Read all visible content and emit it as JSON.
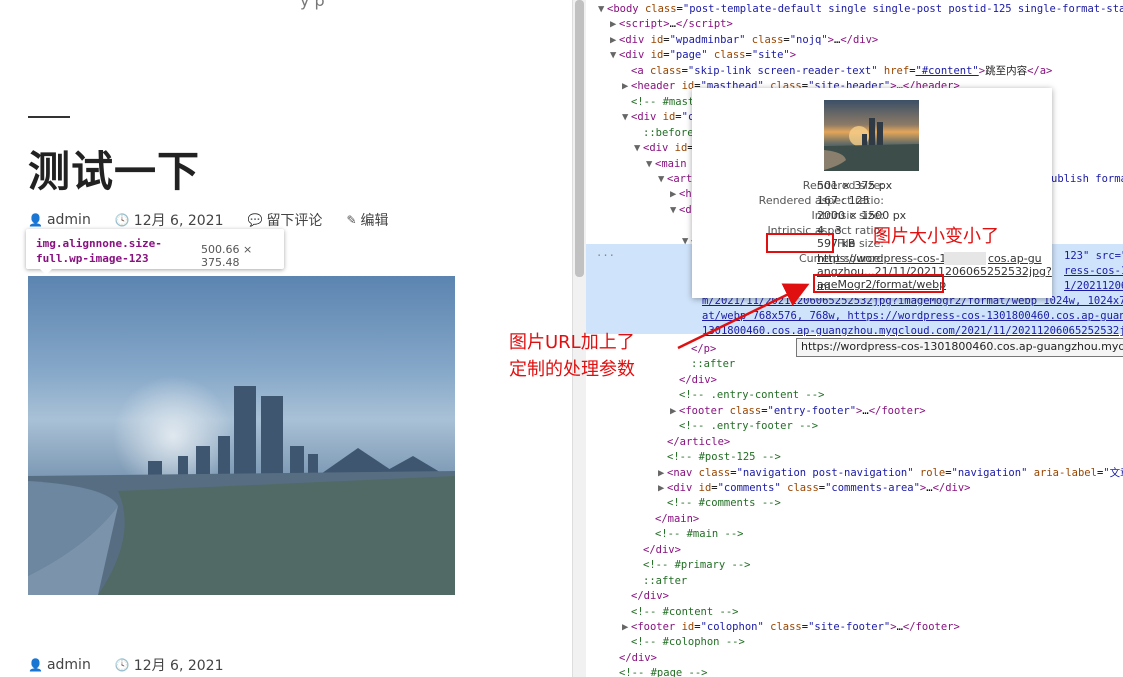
{
  "blog": {
    "top_cut_text": "y  p",
    "post_title": "测试一下",
    "meta1": {
      "author": "admin",
      "date": "12月 6, 2021",
      "comment": "留下评论",
      "edit": "编辑"
    },
    "meta2": {
      "author": "admin",
      "date": "12月 6, 2021"
    },
    "tooltip": {
      "selector": "img.alignnone.size-full.wp-image-123",
      "dimensions": "500.66 × 375.48"
    }
  },
  "devtools": {
    "lines": [
      {
        "t": "▼",
        "h": "<span class='tg'>&lt;body</span> <span class='at'>class</span>=<span class='av'>\"post-template-default single single-post postid-125 single-format-stan</span>"
      },
      {
        "t": "▶",
        "h": "<span class='tg'>&lt;script&gt;</span>…<span class='tg'>&lt;/script&gt;</span>"
      },
      {
        "t": "▶",
        "h": "<span class='tg'>&lt;div</span> <span class='at'>id</span>=<span class='av'>\"wpadminbar\"</span> <span class='at'>class</span>=<span class='av'>\"nojq\"</span><span class='tg'>&gt;</span>…<span class='tg'>&lt;/div&gt;</span>"
      },
      {
        "t": "▼",
        "h": "<span class='tg'>&lt;div</span> <span class='at'>id</span>=<span class='av'>\"page\"</span> <span class='at'>class</span>=<span class='av'>\"site\"</span><span class='tg'>&gt;</span>"
      },
      {
        "t": "",
        "h": "<span class='tg'>&lt;a</span> <span class='at'>class</span>=<span class='av'>\"skip-link screen-reader-text\"</span> <span class='at'>href</span>=<span class='lk'>\"#content\"</span><span class='tg'>&gt;</span><span class='tx'>跳至内容</span><span class='tg'>&lt;/a&gt;</span>"
      },
      {
        "t": "▶",
        "h": "<span class='tg'>&lt;header</span> <span class='at'>id</span>=<span class='av'>\"masthead\"</span> <span class='at'>class</span>=<span class='av'>\"site-header\"</span><span class='tg'>&gt;</span>…<span class='tg'>&lt;/header&gt;</span>"
      },
      {
        "t": "",
        "h": "<span class='cm'>&lt;!-- #mast</span>"
      },
      {
        "t": "▼",
        "h": "<span class='tg'>&lt;div</span> <span class='at'>id</span>=<span class='av'>\"c</span>"
      },
      {
        "t": "",
        "h": "<span class='cm'>::before</span>"
      },
      {
        "t": "▼",
        "h": "<span class='tg'>&lt;div</span> <span class='at'>id</span>="
      },
      {
        "t": "▼",
        "h": "<span class='tg'>&lt;main</span>"
      },
      {
        "t": "▼",
        "h": "<span class='tg'>&lt;art</span>"
      },
      {
        "t": "▶",
        "h": "<span class='tg'>&lt;h</span>"
      },
      {
        "t": "▼",
        "h": "<span class='tg'>&lt;di</span>"
      },
      {
        "t": "",
        "h": ""
      },
      {
        "t": "▼",
        "h": "<span class='tg'>&lt;</span>"
      },
      {
        "t": "",
        "h": ""
      },
      {
        "t": "",
        "h": ""
      },
      {
        "t": "",
        "h": ""
      },
      {
        "t": "",
        "h": ""
      },
      {
        "t": "",
        "h": ""
      },
      {
        "t": "",
        "h": ""
      },
      {
        "t": "",
        "h": "<span class='tg'>&lt;/p&gt;</span>"
      },
      {
        "t": "",
        "h": "<span class='cm'>::after</span>"
      },
      {
        "t": "",
        "h": "<span class='tg'>&lt;/div&gt;</span>"
      },
      {
        "t": "",
        "h": "<span class='cm'>&lt;!-- .entry-content --&gt;</span>"
      },
      {
        "t": "▶",
        "h": "<span class='tg'>&lt;footer</span> <span class='at'>class</span>=<span class='av'>\"entry-footer\"</span><span class='tg'>&gt;</span>…<span class='tg'>&lt;/footer&gt;</span>"
      },
      {
        "t": "",
        "h": "<span class='cm'>&lt;!-- .entry-footer --&gt;</span>"
      },
      {
        "t": "",
        "h": "<span class='tg'>&lt;/article&gt;</span>"
      },
      {
        "t": "",
        "h": "<span class='cm'>&lt;!-- #post-125 --&gt;</span>"
      },
      {
        "t": "▶",
        "h": "<span class='tg'>&lt;nav</span> <span class='at'>class</span>=<span class='av'>\"navigation post-navigation\"</span> <span class='at'>role</span>=<span class='av'>\"navigation\"</span> <span class='at'>aria-label</span>=<span class='av'>\"文章</span>"
      },
      {
        "t": "▶",
        "h": "<span class='tg'>&lt;div</span> <span class='at'>id</span>=<span class='av'>\"comments\"</span> <span class='at'>class</span>=<span class='av'>\"comments-area\"</span><span class='tg'>&gt;</span>…<span class='tg'>&lt;/div&gt;</span>"
      },
      {
        "t": "",
        "h": "<span class='cm'>&lt;!-- #comments --&gt;</span>"
      },
      {
        "t": "",
        "h": "<span class='tg'>&lt;/main&gt;</span>"
      },
      {
        "t": "",
        "h": "<span class='cm'>&lt;!-- #main --&gt;</span>"
      },
      {
        "t": "",
        "h": "<span class='tg'>&lt;/div&gt;</span>"
      },
      {
        "t": "",
        "h": "<span class='cm'>&lt;!-- #primary --&gt;</span>"
      },
      {
        "t": "",
        "h": "<span class='cm'>::after</span>"
      },
      {
        "t": "",
        "h": "<span class='tg'>&lt;/div&gt;</span>"
      },
      {
        "t": "",
        "h": "<span class='cm'>&lt;!-- #content --&gt;</span>"
      },
      {
        "t": "▶",
        "h": "<span class='tg'>&lt;footer</span> <span class='at'>id</span>=<span class='av'>\"colophon\"</span> <span class='at'>class</span>=<span class='av'>\"site-footer\"</span><span class='tg'>&gt;</span>…<span class='tg'>&lt;/footer&gt;</span>"
      },
      {
        "t": "",
        "h": "<span class='cm'>&lt;!-- #colophon --&gt;</span>"
      },
      {
        "t": "",
        "h": "<span class='tg'>&lt;/div&gt;</span>"
      },
      {
        "t": "",
        "h": "<span class='cm'>&lt;!-- #page --&gt;</span>"
      }
    ],
    "line_indents": [
      2,
      3,
      3,
      3,
      4,
      4,
      4,
      4,
      5,
      5,
      6,
      7,
      8,
      8,
      8,
      9,
      9,
      9,
      9,
      9,
      9,
      9,
      9,
      9,
      8,
      8,
      8,
      8,
      7,
      7,
      7,
      7,
      7,
      6,
      6,
      5,
      5,
      5,
      4,
      4,
      4,
      4,
      3,
      3
    ],
    "hl_fragments": {
      "a": "123\" src=\"ht",
      "b": "ress-cos-130",
      "c": "1/2021120606",
      "d": "m/2021/11/20211206065252532jpg?imageMogr2/format/webp 1024w, 1024x768, 1024",
      "e": "at/webp 768x576, 768w, https://wordpress-cos-1301800460.cos.ap-guang",
      "f": "1301800460.cos.ap-guangzhou.myqcloud.com/2021/11/20211206065252532jp",
      "g": "ublish forma"
    },
    "url_tooltip": "https://wordpress-cos-1301800460.cos.ap-guangzhou.myqcloud.com"
  },
  "popup": {
    "rows": [
      {
        "k": "Rendered size:",
        "v": "501 × 375 px"
      },
      {
        "k": "Rendered aspect ratio:",
        "v": "167 : 125"
      },
      {
        "k": "Intrinsic size:",
        "v": "2000 × 1500 px"
      },
      {
        "k": "Intrinsic aspect ratio:",
        "v": "4 : 3"
      },
      {
        "k": "File size:",
        "v": "597 kB"
      }
    ],
    "current_source_label": "Current source:",
    "current_source_url1": "https://wordpress-cos-1",
    "current_source_url1b": "cos.ap-gu",
    "current_source_url2": "angzhou...21/11/20211206065252532jpg?im",
    "current_source_url3": "ageMogr2/format/webp"
  },
  "annotations": {
    "size_note": "图片大小变小了",
    "url_note_line1": "图片URL加上了",
    "url_note_line2": "定制的处理参数"
  },
  "colors": {
    "accent_red": "#e01010",
    "selection_blue": "#cfe3fa",
    "tag": "#881280",
    "attr": "#994500",
    "value": "#1a1aa6"
  }
}
